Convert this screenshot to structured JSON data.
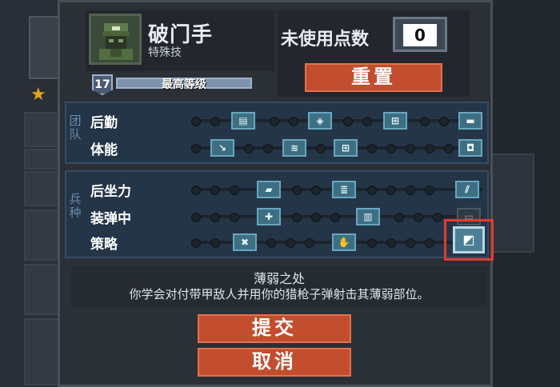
{
  "class_info": {
    "name": "破门手",
    "subtitle": "特殊技",
    "level": "17",
    "level_text": "最高等级"
  },
  "points": {
    "label": "未使用点数",
    "value": "0",
    "reset_label": "重置"
  },
  "groups": {
    "team": {
      "label": "团队",
      "rows": [
        {
          "label": "后勤"
        },
        {
          "label": "体能"
        }
      ]
    },
    "arms": {
      "label": "兵种",
      "rows": [
        {
          "label": "后坐力"
        },
        {
          "label": "装弹中"
        },
        {
          "label": "策略"
        }
      ]
    }
  },
  "selected_skill": {
    "title": "薄弱之处",
    "description": "你学会对付带甲敌人并用你的猎枪子弹射击其薄弱部位。"
  },
  "buttons": {
    "submit": "提交",
    "cancel": "取消"
  },
  "colors": {
    "button": "#c24e2f",
    "selection_outline": "#e53a2e",
    "panel": "#253548"
  }
}
